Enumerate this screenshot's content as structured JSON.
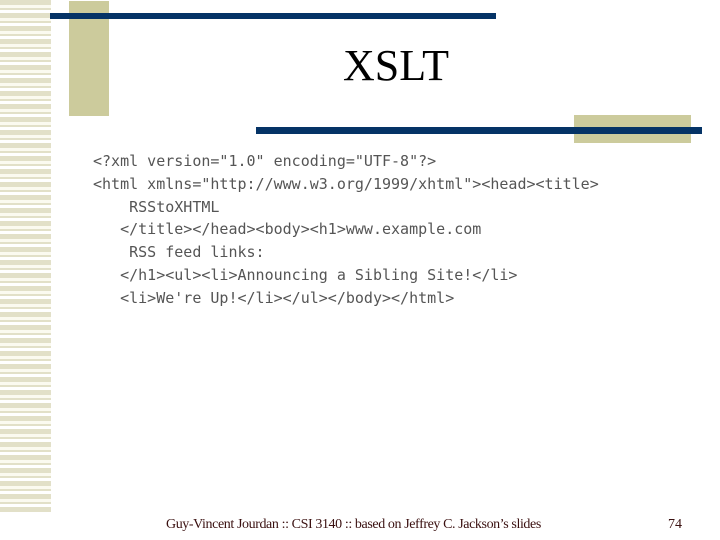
{
  "slide": {
    "title": "XSLT",
    "code_lines": [
      "<?xml version=\"1.0\" encoding=\"UTF-8\"?>",
      "<html xmlns=\"http://www.w3.org/1999/xhtml\"><head><title>",
      "    RSStoXHTML",
      "   </title></head><body><h1>www.example.com",
      "    RSS feed links:",
      "   </h1><ul><li>Announcing a Sibling Site!</li>",
      "   <li>We're Up!</li></ul></body></html>"
    ],
    "footer": "Guy-Vincent Jourdan :: CSI 3140 :: based on Jeffrey C. Jackson’s slides",
    "page_number": "74"
  },
  "colors": {
    "accent_navy": "#053366",
    "accent_tan": "#cccb9c",
    "stripe": "#e2e0c8"
  }
}
